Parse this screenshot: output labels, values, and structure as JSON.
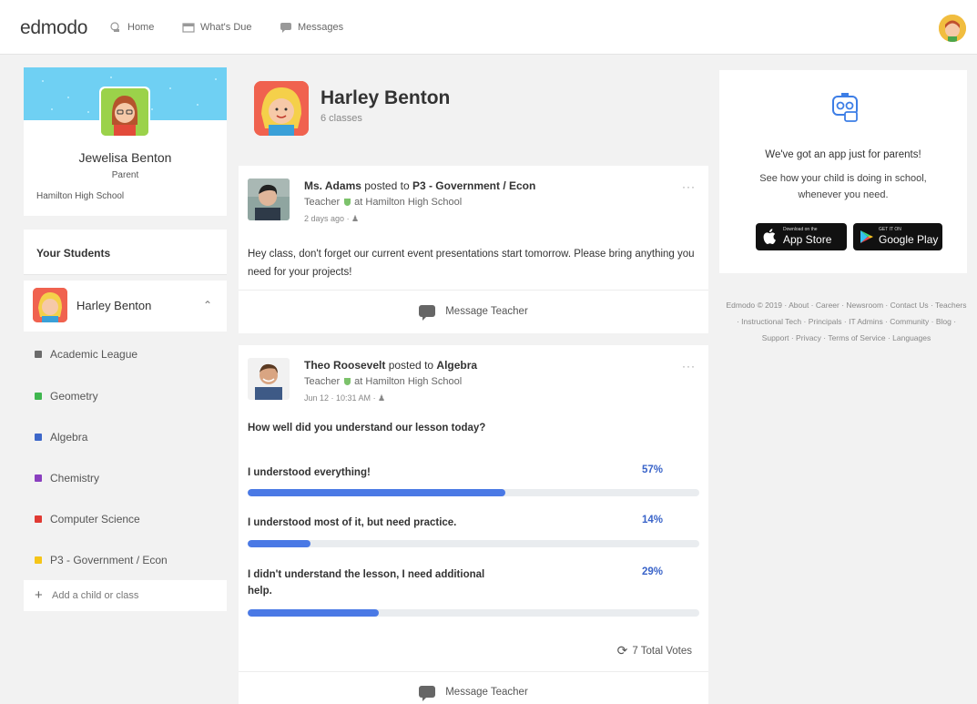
{
  "app": {
    "name": "edmodo"
  },
  "nav": [
    {
      "label": "Home",
      "icon": "home-icon"
    },
    {
      "label": "What's Due",
      "icon": "calendar-icon"
    },
    {
      "label": "Messages",
      "icon": "message-icon"
    }
  ],
  "profile": {
    "name": "Jewelisa Benton",
    "role": "Parent",
    "school": "Hamilton High School"
  },
  "students": {
    "heading": "Your Students",
    "selected": {
      "name": "Harley Benton"
    },
    "classes": [
      {
        "label": "Academic League",
        "color": "#6b6b6b"
      },
      {
        "label": "Geometry",
        "color": "#3fb64f"
      },
      {
        "label": "Algebra",
        "color": "#3d67c9"
      },
      {
        "label": "Chemistry",
        "color": "#8a3fbf"
      },
      {
        "label": "Computer Science",
        "color": "#e03a33"
      },
      {
        "label": "P3 - Government / Econ",
        "color": "#f5c518"
      }
    ],
    "add_label": "Add a child or class"
  },
  "student_header": {
    "name": "Harley Benton",
    "subtitle": "6 classes"
  },
  "posts": [
    {
      "author": "Ms. Adams",
      "posted_to_text": "posted to",
      "group": "P3 - Government / Econ",
      "role_line": "Teacher",
      "school_line": "at Hamilton High School",
      "time": "2 days ago",
      "body": "Hey class, don't forget our current event presentations start tomorrow. Please bring anything you need for your projects!",
      "action": "Message Teacher"
    },
    {
      "author": "Theo Roosevelt",
      "posted_to_text": "posted to",
      "group": "Algebra",
      "role_line": "Teacher",
      "school_line": "at Hamilton High School",
      "time": "Jun 12 · 10:31 AM",
      "poll": {
        "question": "How well did you understand our lesson today?",
        "options": [
          {
            "text": "I understood everything!",
            "percent_label": "57%",
            "fraction": 0.57
          },
          {
            "text": "I understood most of it, but need practice.",
            "percent_label": "14%",
            "fraction": 0.14
          },
          {
            "text": "I didn't understand the lesson, I need additional help.",
            "percent_label": "29%",
            "fraction": 0.29
          }
        ],
        "total_votes": "7 Total Votes"
      },
      "action": "Message Teacher"
    }
  ],
  "promo": {
    "title": "We've got an app just for parents!",
    "subtitle": "See how your child is doing in school, whenever you need.",
    "app_store": {
      "small": "Download on the",
      "big": "App Store"
    },
    "google_play": {
      "small": "GET IT ON",
      "big": "Google Play"
    }
  },
  "footer": {
    "text": "Edmodo © 2019 · About · Career · Newsroom · Contact Us · Teachers · Instructional Tech · Principals · IT Admins · Community · Blog · Support · Privacy · Terms of Service · Languages"
  }
}
